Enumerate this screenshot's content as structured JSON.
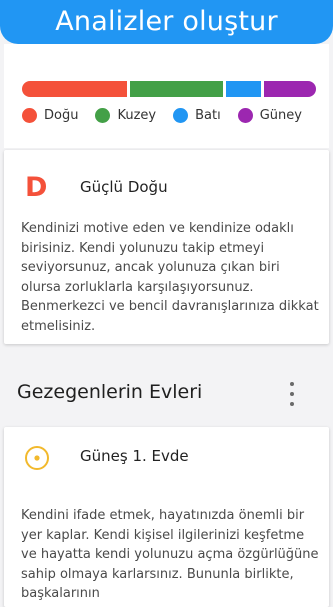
{
  "header": {
    "title": "Analizler oluştur"
  },
  "distribution": {
    "segments": [
      {
        "name": "Doğu",
        "fraction": 0.36,
        "color": "#f4513a"
      },
      {
        "name": "Kuzey",
        "fraction": 0.32,
        "color": "#43a047"
      },
      {
        "name": "Batı",
        "fraction": 0.12,
        "color": "#2196f3"
      },
      {
        "name": "Güney",
        "fraction": 0.18,
        "color": "#9c27b0"
      }
    ],
    "legend": [
      {
        "label": "Doğu",
        "color": "#f4513a"
      },
      {
        "label": "Kuzey",
        "color": "#43a047"
      },
      {
        "label": "Batı",
        "color": "#2196f3"
      },
      {
        "label": "Güney",
        "color": "#9c27b0"
      }
    ]
  },
  "strong_card": {
    "letter": "D",
    "title": "Güçlü Doğu",
    "description": "Kendinizi motive eden ve kendinize odaklı birisiniz. Kendi yolunuzu takip etmeyi seviyorsunuz, ancak yolunuza çıkan biri olursa zorluklarla karşılaşıyorsunuz. Benmerkezci ve bencil davranışlarınıza dikkat etmelisiniz.",
    "accent": "#f4513a"
  },
  "section": {
    "title": "Gezegenlerin Evleri",
    "more_icon": "more-vert-icon"
  },
  "house_card": {
    "icon": "sun-icon",
    "title": "Güneş 1. Evde",
    "description": "Kendini ifade etmek, hayatınızda önemli bir yer kaplar. Kendi kişisel ilgilerinizi keşfetme ve hayatta kendi yolunuzu açma özgürlüğüne sahip olmaya karlarsınız. Bununla birlikte, başkalarının",
    "accent": "#f2b92c"
  }
}
